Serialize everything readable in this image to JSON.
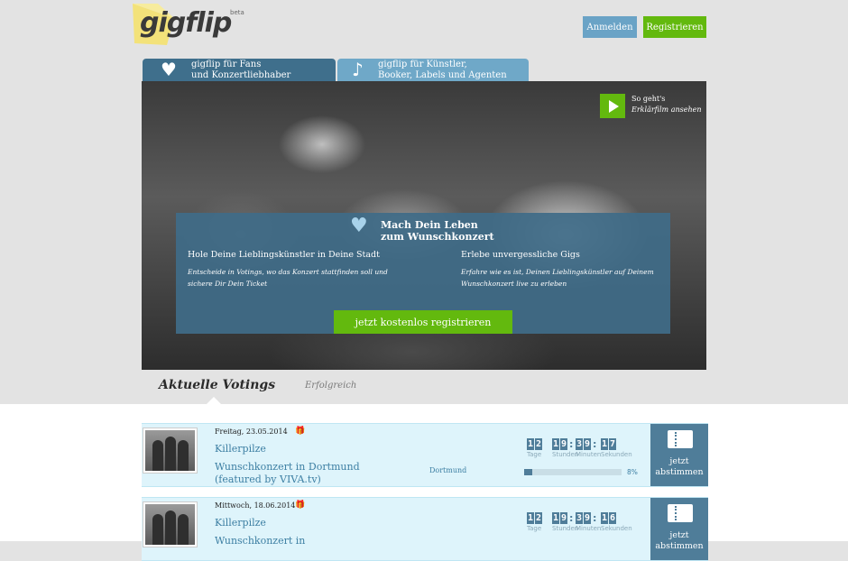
{
  "header": {
    "logo_text": "gigflip",
    "logo_badge": "beta",
    "login_label": "Anmelden",
    "register_label": "Registrieren"
  },
  "tabs": [
    {
      "icon": "heart-icon",
      "line1": "gigflip für Fans",
      "line2": "und Konzertliebhaber"
    },
    {
      "icon": "music-note-icon",
      "line1": "gigflip für Künstler,",
      "line2": "Booker, Labels und Agenten"
    }
  ],
  "hero": {
    "video_line1": "So geht's",
    "video_line2": "Erklärfilm ansehen",
    "title_line1": "Mach Dein Leben",
    "title_line2": "zum Wunschkonzert",
    "left_heading": "Hole Deine Lieblingskünstler in Deine Stadt",
    "left_text": "Entscheide in Votings, wo das Konzert stattfinden soll und sichere Dir Dein Ticket",
    "right_heading": "Erlebe unvergessliche Gigs",
    "right_text": "Erfahre wie es ist, Deinen Lieblingskünstler auf Deinem Wunschkonzert live zu erleben",
    "cta_label": "jetzt kostenlos registrieren"
  },
  "section": {
    "active_tab": "Aktuelle Votings",
    "other_tab": "Erfolgreich"
  },
  "countdown_labels": {
    "days": "Tage",
    "hours": "Stunden",
    "minutes": "Minuten",
    "seconds": "Sekunden"
  },
  "votings": [
    {
      "date": "Freitag, 23.05.2014",
      "artist": "Killerpilze",
      "event": "Wunschkonzert in Dortmund (featured by VIVA.tv)",
      "city": "Dortmund",
      "countdown": {
        "days": "12",
        "hours": "19",
        "minutes": "39",
        "seconds": "17"
      },
      "progress_percent": 8,
      "progress_label": "8%",
      "vote_line1": "jetzt",
      "vote_line2": "abstimmen"
    },
    {
      "date": "Mittwoch, 18.06.2014",
      "artist": "Killerpilze",
      "event": "Wunschkonzert in",
      "city": "",
      "countdown": {
        "days": "12",
        "hours": "19",
        "minutes": "39",
        "seconds": "16"
      },
      "progress_percent": 0,
      "progress_label": "",
      "vote_line1": "jetzt",
      "vote_line2": "abstimmen"
    }
  ]
}
